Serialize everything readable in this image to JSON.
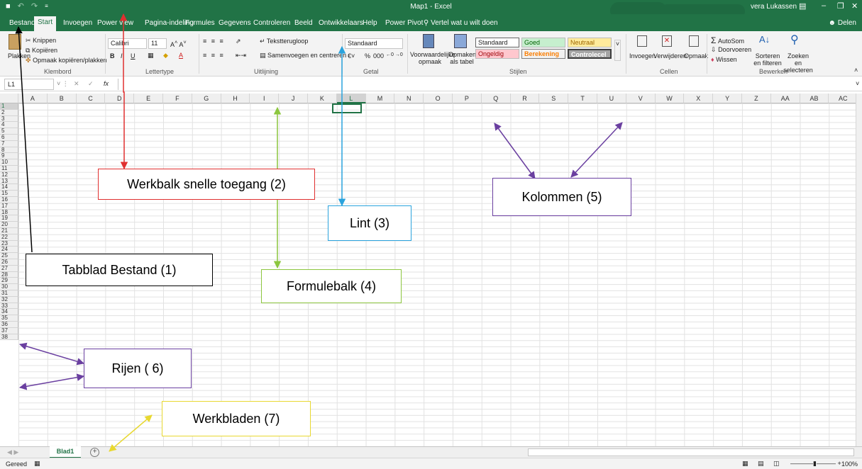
{
  "titlebar": {
    "doc_title": "Map1  -  Excel",
    "user": "vera Lukassen",
    "qat_save": "💾",
    "qat_undo": "↶",
    "qat_redo": "↷",
    "qat_more": "≡"
  },
  "tabs": [
    "Bestand",
    "Start",
    "Invoegen",
    "Power view",
    "Pagina-indeling",
    "Formules",
    "Gegevens",
    "Controleren",
    "Beeld",
    "Ontwikkelaars",
    "Help",
    "Power Pivot"
  ],
  "tell_me": "Vertel wat u wilt doen",
  "share": "Delen",
  "ribbon": {
    "clipboard": {
      "paste": "Plakken",
      "cut": "Knippen",
      "copy": "Kopiëren",
      "format_painter": "Opmaak kopiëren/plakken",
      "label": "Klembord"
    },
    "font": {
      "name": "Calibri",
      "size": "11",
      "bold": "B",
      "italic": "I",
      "underline": "U",
      "label": "Lettertype"
    },
    "alignment": {
      "wrap": "Tekstterugloop",
      "merge": "Samenvoegen en centreren",
      "label": "Uitlijning"
    },
    "number": {
      "format": "Standaard",
      "percent": "%",
      "thousands": "000",
      "label": "Getal"
    },
    "styles": {
      "conditional": "Voorwaardelijke opmaak",
      "as_table": "Opmaken als tabel",
      "cells": [
        "Standaard",
        "Goed",
        "Neutraal",
        "Ongeldig",
        "Berekening",
        "Controlecel"
      ],
      "label": "Stijlen"
    },
    "cells_group": {
      "insert": "Invoegen",
      "delete": "Verwijderen",
      "format": "Opmaak",
      "label": "Cellen"
    },
    "editing": {
      "autosum": "AutoSom",
      "fill": "Doorvoeren",
      "clear": "Wissen",
      "sort": "Sorteren en filteren",
      "find": "Zoeken en selecteren",
      "label": "Bewerken"
    }
  },
  "formula_bar": {
    "name_box": "L1",
    "fx": "fx",
    "cancel": "✕",
    "confirm": "✓"
  },
  "columns": [
    "A",
    "B",
    "C",
    "D",
    "E",
    "F",
    "G",
    "H",
    "I",
    "J",
    "K",
    "L",
    "M",
    "N",
    "O",
    "P",
    "Q",
    "R",
    "S",
    "T",
    "U",
    "V",
    "W",
    "X",
    "Y",
    "Z",
    "AA",
    "AB",
    "AC"
  ],
  "rows": [
    "1",
    "2",
    "3",
    "4",
    "5",
    "6",
    "7",
    "8",
    "9",
    "10",
    "11",
    "12",
    "13",
    "14",
    "15",
    "16",
    "17",
    "18",
    "19",
    "20",
    "21",
    "22",
    "23",
    "24",
    "25",
    "26",
    "27",
    "28",
    "29",
    "30",
    "31",
    "32",
    "33",
    "34",
    "35",
    "36",
    "37",
    "38"
  ],
  "sheets": [
    "Blad1"
  ],
  "status": {
    "ready": "Gereed",
    "zoom": "100%"
  },
  "callouts": {
    "c1": "Tabblad Bestand (1)",
    "c2": "Werkbalk snelle toegang (2)",
    "c3": "Lint (3)",
    "c4": "Formulebalk (4)",
    "c5": "Kolommen (5)",
    "c6": "Rijen ( 6)",
    "c7": "Werkbladen (7)"
  },
  "callout_colors": {
    "c1": "#000000",
    "c2": "#e03030",
    "c3": "#2aa3dd",
    "c4": "#8cc63f",
    "c5": "#6a3fa0",
    "c6": "#6a3fa0",
    "c7": "#f0e040"
  }
}
